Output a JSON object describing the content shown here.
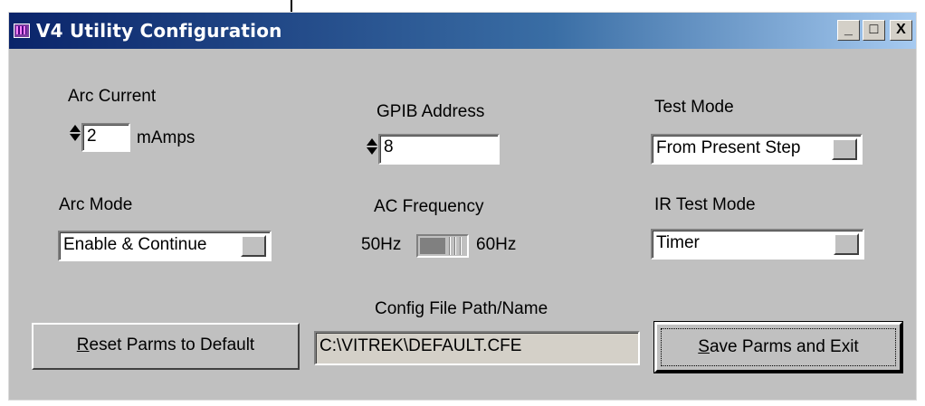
{
  "window": {
    "title": "V4 Utility Configuration",
    "controls": {
      "minimize": "_",
      "maximize": "□",
      "close": "X"
    }
  },
  "arc_current": {
    "label": "Arc Current",
    "value": "2",
    "unit": "mAmps"
  },
  "gpib": {
    "label": "GPIB Address",
    "value": "8"
  },
  "test_mode": {
    "label": "Test Mode",
    "value": "From Present Step"
  },
  "arc_mode": {
    "label": "Arc Mode",
    "value": "Enable & Continue"
  },
  "ac_frequency": {
    "label": "AC Frequency",
    "left_option": "50Hz",
    "right_option": "60Hz",
    "selected": "60Hz"
  },
  "ir_test_mode": {
    "label": "IR Test Mode",
    "value": "Timer"
  },
  "config_file": {
    "label": "Config File Path/Name",
    "value": "C:\\VITREK\\DEFAULT.CFE"
  },
  "buttons": {
    "reset_mnemonic": "R",
    "reset_rest": "eset Parms to Default",
    "save_mnemonic": "S",
    "save_rest": "ave Parms and Exit"
  },
  "icons": {
    "app": "app-icon",
    "spinner": "spinner-icon",
    "cursor": "arrow-cursor-icon",
    "dropdown": "dropdown-arrow-icon"
  }
}
